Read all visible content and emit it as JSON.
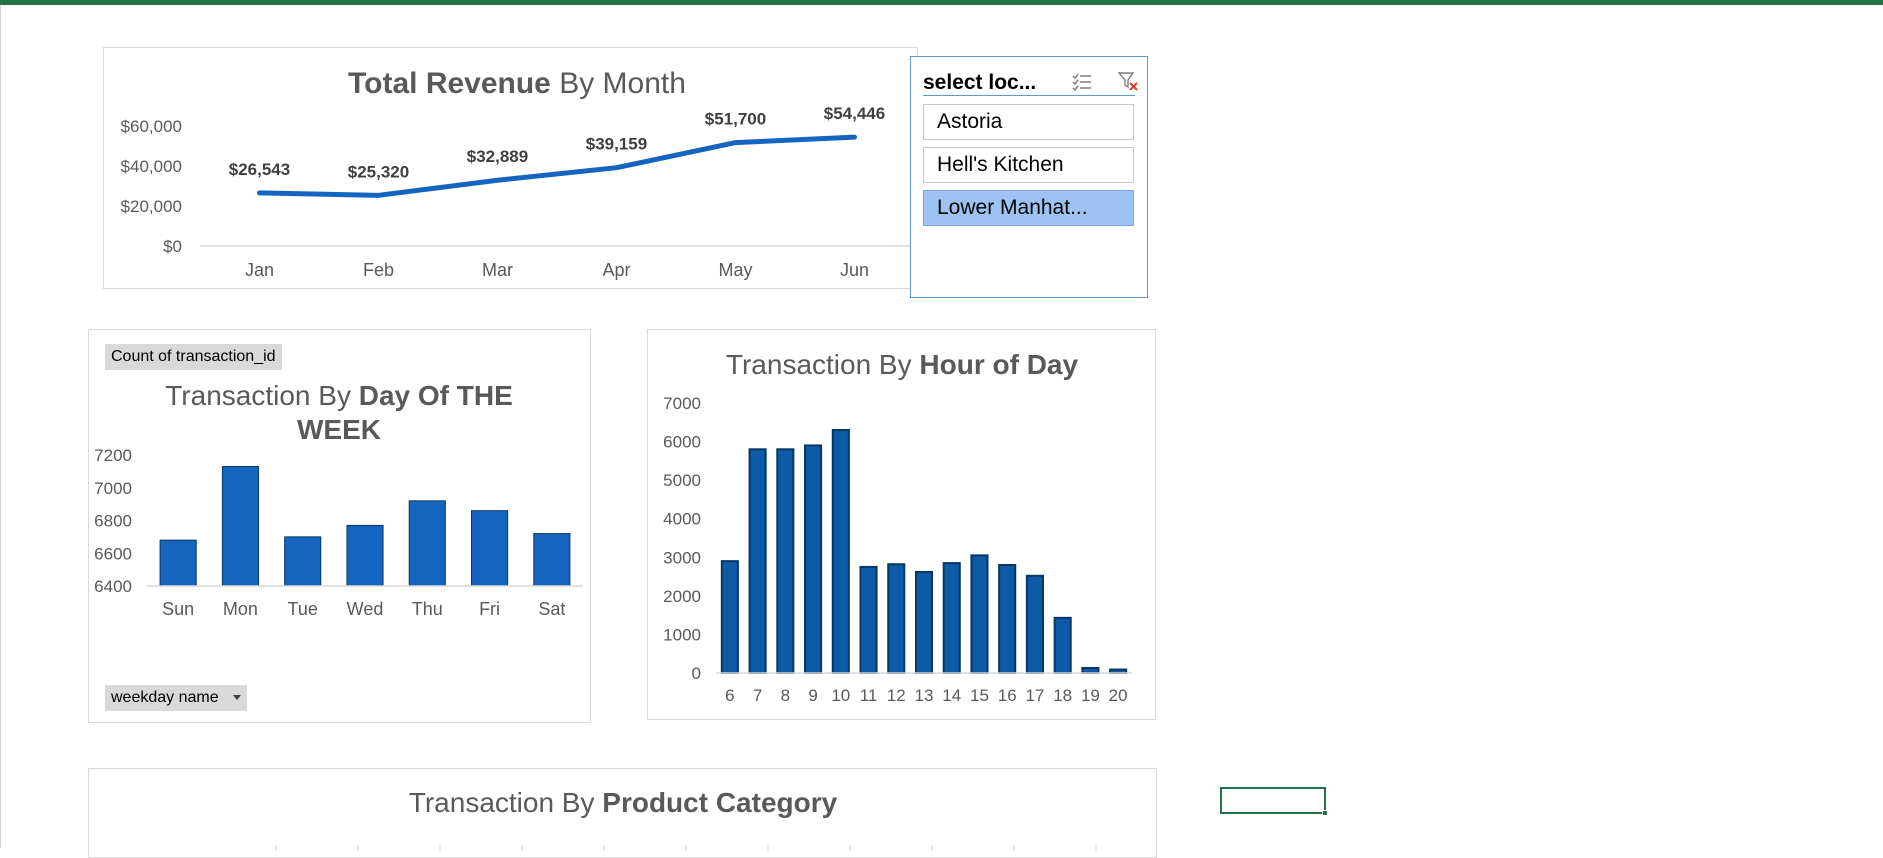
{
  "revenue_chart": {
    "title_bold": "Total Revenue",
    "title_rest": " By Month"
  },
  "day_chart": {
    "title_line1_plain": "Transaction By ",
    "title_line1_bold": "Day Of THE",
    "title_line2": "WEEK",
    "pivot_value_button": "Count of transaction_id",
    "pivot_axis_button": "weekday name"
  },
  "hour_chart": {
    "title_plain": "Transaction By ",
    "title_bold": "Hour of Day"
  },
  "category_chart": {
    "title_plain": "Transaction By ",
    "title_bold": "Product Category"
  },
  "slicer": {
    "title": "select loc...",
    "multiselect_icon": "multi-select-icon",
    "clear_icon": "clear-filter-icon",
    "items": [
      {
        "label": "Astoria",
        "selected": false
      },
      {
        "label": "Hell's Kitchen",
        "selected": false
      },
      {
        "label": "Lower Manhat...",
        "selected": true
      }
    ]
  },
  "colors": {
    "line": "#1565c0",
    "bar": "#1565c0",
    "bar_dark": "#0d5aa7",
    "bar_outline": "#073763",
    "slicer_border": "#5b9bd5",
    "slicer_selected": "#9dc3f3",
    "excel_green": "#217346"
  },
  "chart_data": [
    {
      "type": "line",
      "title": "Total Revenue By Month",
      "categories": [
        "Jan",
        "Feb",
        "Mar",
        "Apr",
        "May",
        "Jun"
      ],
      "values": [
        26543,
        25320,
        32889,
        39159,
        51700,
        54446
      ],
      "data_labels": [
        "$26,543",
        "$25,320",
        "$32,889",
        "$39,159",
        "$51,700",
        "$54,446"
      ],
      "yticks": [
        "$0",
        "$20,000",
        "$40,000",
        "$60,000"
      ],
      "ylim": [
        0,
        60000
      ],
      "grid": false
    },
    {
      "type": "bar",
      "title": "Transaction By Day Of THE WEEK",
      "categories": [
        "Sun",
        "Mon",
        "Tue",
        "Wed",
        "Thu",
        "Fri",
        "Sat"
      ],
      "values": [
        6680,
        7130,
        6700,
        6770,
        6920,
        6860,
        6720
      ],
      "yticks": [
        "6400",
        "6600",
        "6800",
        "7000",
        "7200"
      ],
      "ylim": [
        6400,
        7200
      ],
      "grid": false
    },
    {
      "type": "bar",
      "title": "Transaction By Hour of Day",
      "categories": [
        "6",
        "7",
        "8",
        "9",
        "10",
        "11",
        "12",
        "13",
        "14",
        "15",
        "16",
        "17",
        "18",
        "19",
        "20"
      ],
      "values": [
        2900,
        5800,
        5800,
        5900,
        6300,
        2750,
        2820,
        2620,
        2850,
        3050,
        2800,
        2520,
        1430,
        130,
        90
      ],
      "yticks": [
        "0",
        "1000",
        "2000",
        "3000",
        "4000",
        "5000",
        "6000",
        "7000"
      ],
      "ylim": [
        0,
        7000
      ],
      "grid": false
    }
  ]
}
